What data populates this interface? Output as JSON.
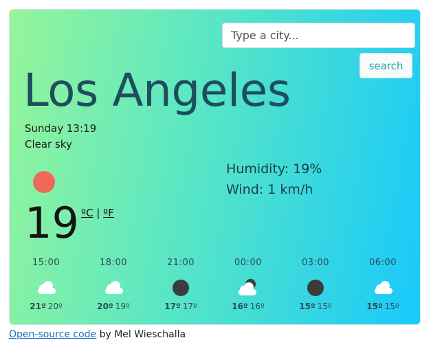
{
  "search": {
    "placeholder": "Type a city...",
    "button_label": "search"
  },
  "weather": {
    "city": "Los Angeles",
    "datetime": "Sunday 13:19",
    "condition": "Clear sky",
    "icon": "sun-icon",
    "temperature": "19",
    "unit_celsius": "ºC",
    "unit_separator": "|",
    "unit_fahrenheit": "ºF",
    "humidity": "Humidity: 19%",
    "wind": "Wind: 1 km/h"
  },
  "forecast": [
    {
      "time": "15:00",
      "icon": "cloud-icon",
      "max": "21º",
      "min": "20º"
    },
    {
      "time": "18:00",
      "icon": "cloud-icon",
      "max": "20º",
      "min": "19º"
    },
    {
      "time": "21:00",
      "icon": "moon-icon",
      "max": "17º",
      "min": "17º"
    },
    {
      "time": "00:00",
      "icon": "moon-cloud-icon",
      "max": "16º",
      "min": "16º"
    },
    {
      "time": "03:00",
      "icon": "moon-icon",
      "max": "15º",
      "min": "15º"
    },
    {
      "time": "06:00",
      "icon": "cloud-icon",
      "max": "15º",
      "min": "15º"
    }
  ],
  "footer": {
    "link_text": "Open-source code",
    "author_text": " by Mel Wieschalla"
  },
  "colors": {
    "gradient_start": "#96f59a",
    "gradient_end": "#18c9fb",
    "sun": "#ef6a58",
    "moon": "#3b3c3e",
    "city_text": "#1d4e5e",
    "search_button_text": "#2ea79a",
    "link": "#1e6db7"
  }
}
